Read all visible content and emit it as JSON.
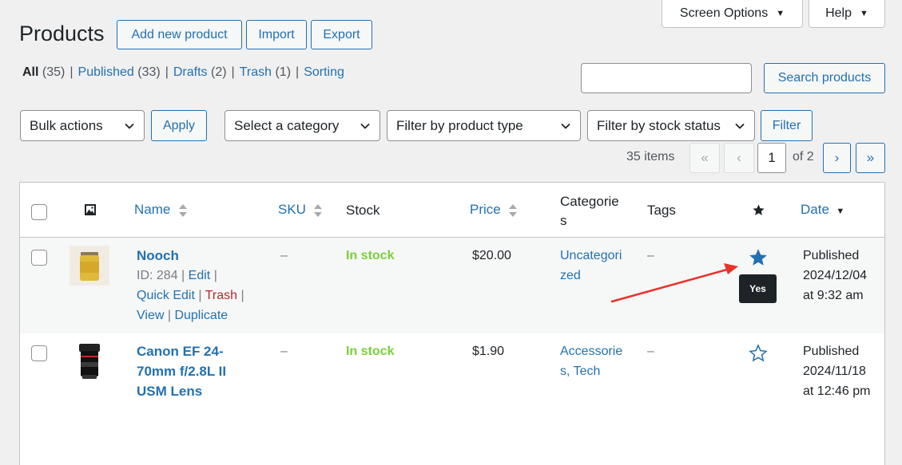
{
  "header": {
    "title": "Products",
    "add_new_label": "Add new product",
    "import_label": "Import",
    "export_label": "Export",
    "screen_options_label": "Screen Options",
    "help_label": "Help"
  },
  "subsubsub": {
    "all_label": "All",
    "all_count": "(35)",
    "published_label": "Published",
    "published_count": "(33)",
    "drafts_label": "Drafts",
    "drafts_count": "(2)",
    "trash_label": "Trash",
    "trash_count": "(1)",
    "sorting_label": "Sorting",
    "separator": "|"
  },
  "search": {
    "value": "",
    "button_label": "Search products"
  },
  "filters": {
    "bulk_actions": "Bulk actions",
    "apply_label": "Apply",
    "category": "Select a category",
    "product_type": "Filter by product type",
    "stock_status": "Filter by stock status",
    "filter_label": "Filter"
  },
  "pagination": {
    "items_count": "35 items",
    "first": "«",
    "prev": "‹",
    "current_page": "1",
    "of_total": "of 2",
    "next": "›",
    "last": "»"
  },
  "table": {
    "columns": {
      "name": "Name",
      "sku": "SKU",
      "stock": "Stock",
      "price": "Price",
      "categories_line1": "Categorie",
      "categories_line2": "s",
      "tags": "Tags",
      "date": "Date"
    },
    "rows": [
      {
        "name": "Nooch",
        "id_text": "ID: 284",
        "edit": "Edit",
        "quick_edit": "Quick Edit",
        "trash": "Trash",
        "view": "View",
        "duplicate": "Duplicate",
        "sep": "|",
        "sku": "–",
        "stock": "In stock",
        "price": "$20.00",
        "category_line1": "Uncategori",
        "category_line2": "zed",
        "tags": "–",
        "featured": true,
        "featured_tooltip": "Yes",
        "date_status": "Published",
        "date_value": "2024/12/04",
        "date_time": "at 9:32 am"
      },
      {
        "name_line1": "Canon EF 24-",
        "name_line2": "70mm f/2.8L II",
        "name_line3": "USM Lens",
        "sku": "–",
        "stock": "In stock",
        "price": "$1.90",
        "category_line1": "Accessorie",
        "category_line2": "s, Tech",
        "tags": "–",
        "featured": false,
        "date_status": "Published",
        "date_value": "2024/11/18",
        "date_time": "at 12:46 pm"
      }
    ]
  },
  "colors": {
    "link": "#2271b1",
    "in_stock": "#7ad03a",
    "trash": "#b32d2e",
    "annotation_arrow": "#e8332a"
  }
}
